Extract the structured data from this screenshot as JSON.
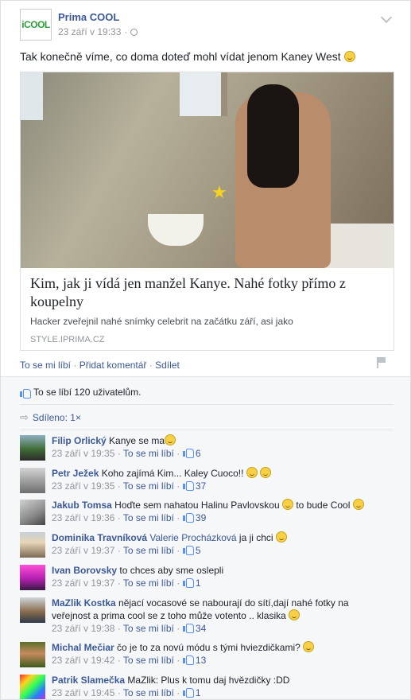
{
  "post": {
    "page_name": "Prima COOL",
    "page_logo_text": "iCOOL",
    "timestamp": "23 září v 19:33",
    "meta_sep": "·",
    "text": "Tak konečně víme, co doma doteď mohl vídat jenom Kaney West"
  },
  "link": {
    "title": "Kim, jak ji vídá jen manžel Kanye. Nahé fotky přímo z koupelny",
    "description": "Hacker zveřejnil nahé snímky celebrit na začátku září, asi jako",
    "source": "STYLE.IPRIMA.CZ"
  },
  "actions": {
    "like": "To se mi líbí",
    "comment": "Přidat komentář",
    "share": "Sdílet",
    "sep": "·"
  },
  "ufi": {
    "likes_summary": "To se líbí 120 uživatelům.",
    "shares_summary": "Sdíleno: 1×"
  },
  "comments": [
    {
      "name": "Filip Orlický",
      "tag": "",
      "text": "Kanye se ma",
      "time": "23 září v 19:35",
      "like": "To se mi líbí",
      "count": "6",
      "emoji": 1
    },
    {
      "name": "Petr Ježek",
      "tag": "",
      "text": "Koho zajímá Kim... Kaley Cuoco!!",
      "time": "23 září v 19:35",
      "like": "To se mi líbí",
      "count": "37",
      "emoji": 2
    },
    {
      "name": "Jakub Tomsa",
      "tag": "",
      "text": "Hoďte sem nahatou Halinu Pavlovskou",
      "text2": "to bude Cool",
      "time": "23 září v 19:36",
      "like": "To se mi líbí",
      "count": "39",
      "emoji": 1
    },
    {
      "name": "Dominika Travníková",
      "tag": "Valerie Procházková",
      "text": "ja ji chci",
      "time": "23 září v 19:37",
      "like": "To se mi líbí",
      "count": "5",
      "emoji": 1
    },
    {
      "name": "Ivan Borovsky",
      "tag": "",
      "text": "to chces aby sme oslepli",
      "time": "23 září v 19:37",
      "like": "To se mi líbí",
      "count": "1",
      "emoji": 0
    },
    {
      "name": "MaZlik Kostka",
      "tag": "",
      "text": "nějací vocasové se nabourají do sítí,dají nahé fotky na veřejnost a prima cool se z toho může votento .. klasika",
      "time": "23 září v 19:38",
      "like": "To se mi líbí",
      "count": "34",
      "emoji": 1
    },
    {
      "name": "Michal Mečiar",
      "tag": "",
      "text": "čo je to za novú módu s tými hviezdičkami?",
      "time": "23 září v 19:42",
      "like": "To se mi líbí",
      "count": "13",
      "emoji": 1
    },
    {
      "name": "Patrik Slamečka",
      "tag": "",
      "text": "MaZlik: Plus k tomu daj hvězdičky :DD",
      "time": "23 září v 19:45",
      "like": "To se mi líbí",
      "count": "1",
      "emoji": 0
    }
  ]
}
